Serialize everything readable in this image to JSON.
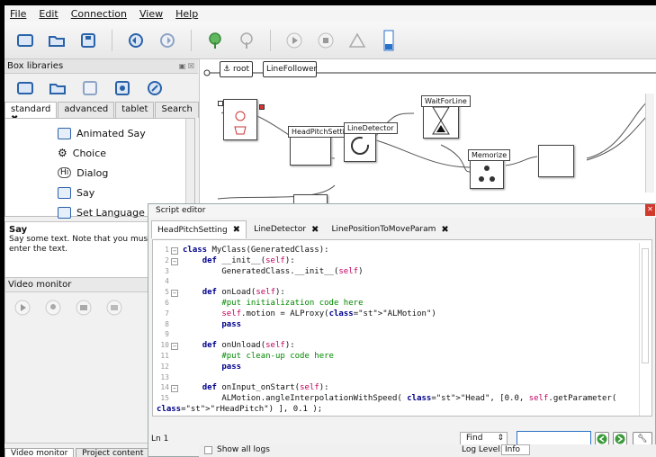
{
  "menu": [
    "File",
    "Edit",
    "Connection",
    "View",
    "Help"
  ],
  "box_libraries": {
    "title": "Box libraries",
    "tabs": [
      "standard",
      "advanced",
      "tablet",
      "Search"
    ],
    "items": [
      "Animated Say",
      "Choice",
      "Dialog",
      "Say",
      "Set Language"
    ]
  },
  "info": {
    "title": "Say",
    "text": "Say some text. Note that you must open enter the text."
  },
  "video_monitor": {
    "title": "Video monitor"
  },
  "bottom_tabs": [
    "Video monitor",
    "Project content"
  ],
  "breadcrumb": {
    "root": "root",
    "child": "LineFollower"
  },
  "boxes": {
    "line_detector": "LineDetector",
    "wait_line": "WaitForLine",
    "memorize": "Memorize",
    "head_pitch": "HeadPitchSetting"
  },
  "editor": {
    "title": "Script editor",
    "tabs": [
      "HeadPitchSetting",
      "LineDetector",
      "LinePositionToMoveParam"
    ],
    "status": "Ln 1",
    "find_label": "Find"
  },
  "code_lines": [
    {
      "n": "1",
      "text": "class MyClass(GeneratedClass):"
    },
    {
      "n": "2",
      "text": "    def __init__(self):"
    },
    {
      "n": "3",
      "text": "        GeneratedClass.__init__(self)"
    },
    {
      "n": "4",
      "text": ""
    },
    {
      "n": "5",
      "text": "    def onLoad(self):"
    },
    {
      "n": "6",
      "text": "        #put initialization code here"
    },
    {
      "n": "7",
      "text": "        self.motion = ALProxy(\"ALMotion\")"
    },
    {
      "n": "8",
      "text": "        pass"
    },
    {
      "n": "9",
      "text": ""
    },
    {
      "n": "10",
      "text": "    def onUnload(self):"
    },
    {
      "n": "11",
      "text": "        #put clean-up code here"
    },
    {
      "n": "12",
      "text": "        pass"
    },
    {
      "n": "13",
      "text": ""
    },
    {
      "n": "14",
      "text": "    def onInput_onStart(self):"
    },
    {
      "n": "15",
      "text": "        ALMotion.angleInterpolationWithSpeed( \"Head\", [0.0, self.getParameter("
    },
    {
      "n": "",
      "text": "\"rHeadPitch\") ], 0.1 );"
    }
  ],
  "log": {
    "show_all": "Show all logs",
    "level_label": "Log Level:",
    "level": "Info"
  }
}
